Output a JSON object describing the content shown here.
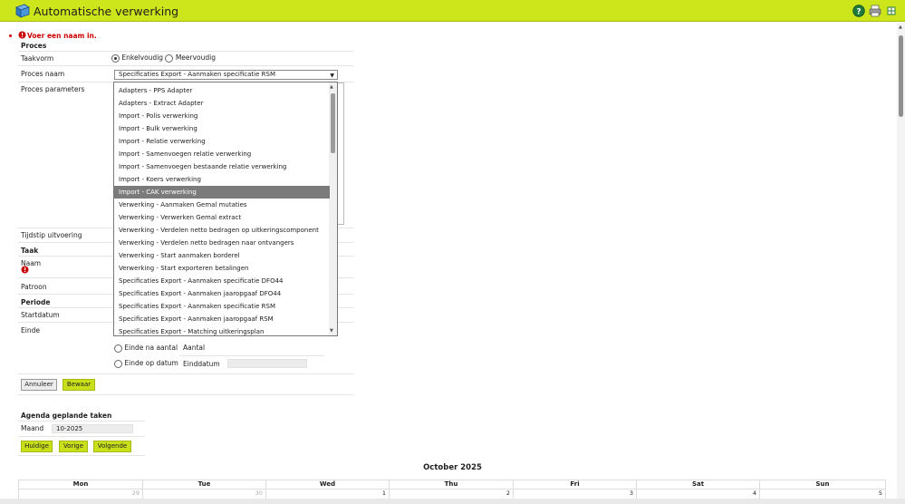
{
  "header": {
    "title": "Automatische verwerking",
    "icons": [
      "app-cube-icon",
      "help-icon",
      "print-icon",
      "export-icon"
    ]
  },
  "error": {
    "message": "Voer een naam in."
  },
  "proces": {
    "section_title": "Proces",
    "taakvorm_label": "Taakvorm",
    "taakvorm_options": [
      "Enkelvoudig",
      "Meervoudig"
    ],
    "taakvorm_selected": "Enkelvoudig",
    "proces_naam_label": "Proces naam",
    "proces_naam_value": "Specificaties Export - Aanmaken specificatie RSM",
    "proces_parameters_label": "Proces parameters",
    "tijdstip_label": "Tijdstip uitvoering"
  },
  "dropdown": {
    "selected_index": 8,
    "items": [
      "Adapters - PPS Adapter",
      "Adapters - Extract Adapter",
      "Import - Polis verwerking",
      "Import - Bulk verwerking",
      "Import - Relatie verwerking",
      "Import - Samenvoegen relatie verwerking",
      "Import - Samenvoegen bestaande relatie verwerking",
      "Import - Koers verwerking",
      "Import - CAK verwerking",
      "Verwerking - Aanmaken Gemal mutaties",
      "Verwerking - Verwerken Gemal extract",
      "Verwerking - Verdelen netto bedragen op uitkeringscomponent",
      "Verwerking - Verdelen netto bedragen naar ontvangers",
      "Verwerking - Start aanmaken borderel",
      "Verwerking - Start exporteren betalingen",
      "Specificaties Export - Aanmaken specificatie DFO44",
      "Specificaties Export - Aanmaken jaaropgaaf DFO44",
      "Specificaties Export - Aanmaken specificatie RSM",
      "Specificaties Export - Aanmaken jaaropgaaf RSM",
      "Specificaties Export - Matching uitkeringsplan"
    ]
  },
  "taak": {
    "section_title": "Taak",
    "naam_label": "Naam",
    "patroon_label": "Patroon"
  },
  "periode": {
    "section_title": "Periode",
    "startdatum_label": "Startdatum",
    "einde_label": "Einde",
    "einde_na_aantal_label": "Einde na aantal",
    "aantal_label": "Aantal",
    "einde_op_datum_label": "Einde op datum",
    "einddatum_label": "Einddatum"
  },
  "buttons": {
    "annuleer": "Annuleer",
    "bewaar": "Bewaar"
  },
  "agenda": {
    "title": "Agenda geplande taken",
    "maand_label": "Maand",
    "maand_value": "10-2025",
    "huidige": "Huidige",
    "vorige": "Vorige",
    "volgende": "Volgende"
  },
  "calendar": {
    "month_title": "October 2025",
    "days": [
      "Mon",
      "Tue",
      "Wed",
      "Thu",
      "Fri",
      "Sat",
      "Sun"
    ],
    "first_row": [
      "29",
      "30",
      "1",
      "2",
      "3",
      "4",
      "5"
    ]
  },
  "colors": {
    "accent": "#cde61c",
    "error": "#cc0000",
    "selected_item": "#7b7b7b"
  }
}
